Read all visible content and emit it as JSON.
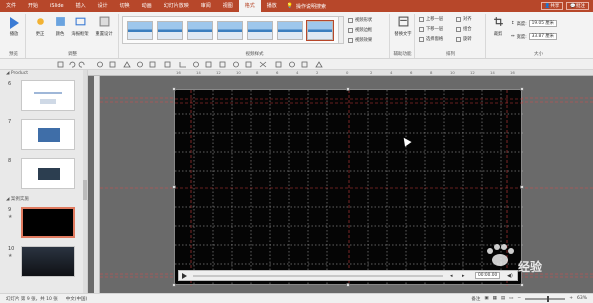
{
  "tabs": [
    {
      "label": "文件"
    },
    {
      "label": "开始"
    },
    {
      "label": "iSlide"
    },
    {
      "label": "插入"
    },
    {
      "label": "设计"
    },
    {
      "label": "切换"
    },
    {
      "label": "动画"
    },
    {
      "label": "幻灯片放映"
    },
    {
      "label": "审阅"
    },
    {
      "label": "视图"
    },
    {
      "label": "格式"
    },
    {
      "label": "播放"
    }
  ],
  "active_tab": "格式",
  "tell_me": "操作说明搜索",
  "share_label": "共享",
  "comment_label": "批注",
  "ribbon": {
    "preview_group": {
      "label": "预览",
      "play": "播放"
    },
    "adjust_group": {
      "label": "调整",
      "corrections": "更正",
      "color": "颜色",
      "poster_frame": "海报框架",
      "reset": "重置设计"
    },
    "styles_group": {
      "label": "视频样式",
      "shape": "视频形状",
      "border": "视频边框",
      "effects": "视频效果"
    },
    "accessibility_group": {
      "label": "辅助功能",
      "alt_text": "替换文字"
    },
    "arrange_group": {
      "label": "排列",
      "bring_forward": "上移一层",
      "send_backward": "下移一层",
      "selection_pane": "选择窗格",
      "align": "对齐",
      "group": "组合",
      "rotate": "旋转"
    },
    "size_group": {
      "label": "大小",
      "crop": "裁剪",
      "height_label": "高度:",
      "height_value": "19.05 厘米",
      "width_label": "宽度:",
      "width_value": "33.87 厘米"
    }
  },
  "thumbnails": {
    "section_top": "Product",
    "section_bottom": "案例实施",
    "slides": [
      {
        "num": "6",
        "style": "light"
      },
      {
        "num": "7",
        "style": "light"
      },
      {
        "num": "8",
        "style": "light"
      },
      {
        "num": "9",
        "style": "active"
      },
      {
        "num": "10",
        "style": "dark"
      }
    ]
  },
  "ruler_ticks": [
    "16",
    "14",
    "12",
    "10",
    "8",
    "6",
    "4",
    "2",
    "0",
    "2",
    "4",
    "6",
    "8",
    "10",
    "12",
    "14",
    "16"
  ],
  "player": {
    "time": "00:00.00"
  },
  "status": {
    "slide_info": "幻灯片 第 9 张，共 10 张",
    "language": "中文(中国)",
    "notes": "备注",
    "zoom": "63%"
  },
  "watermark": "经验"
}
